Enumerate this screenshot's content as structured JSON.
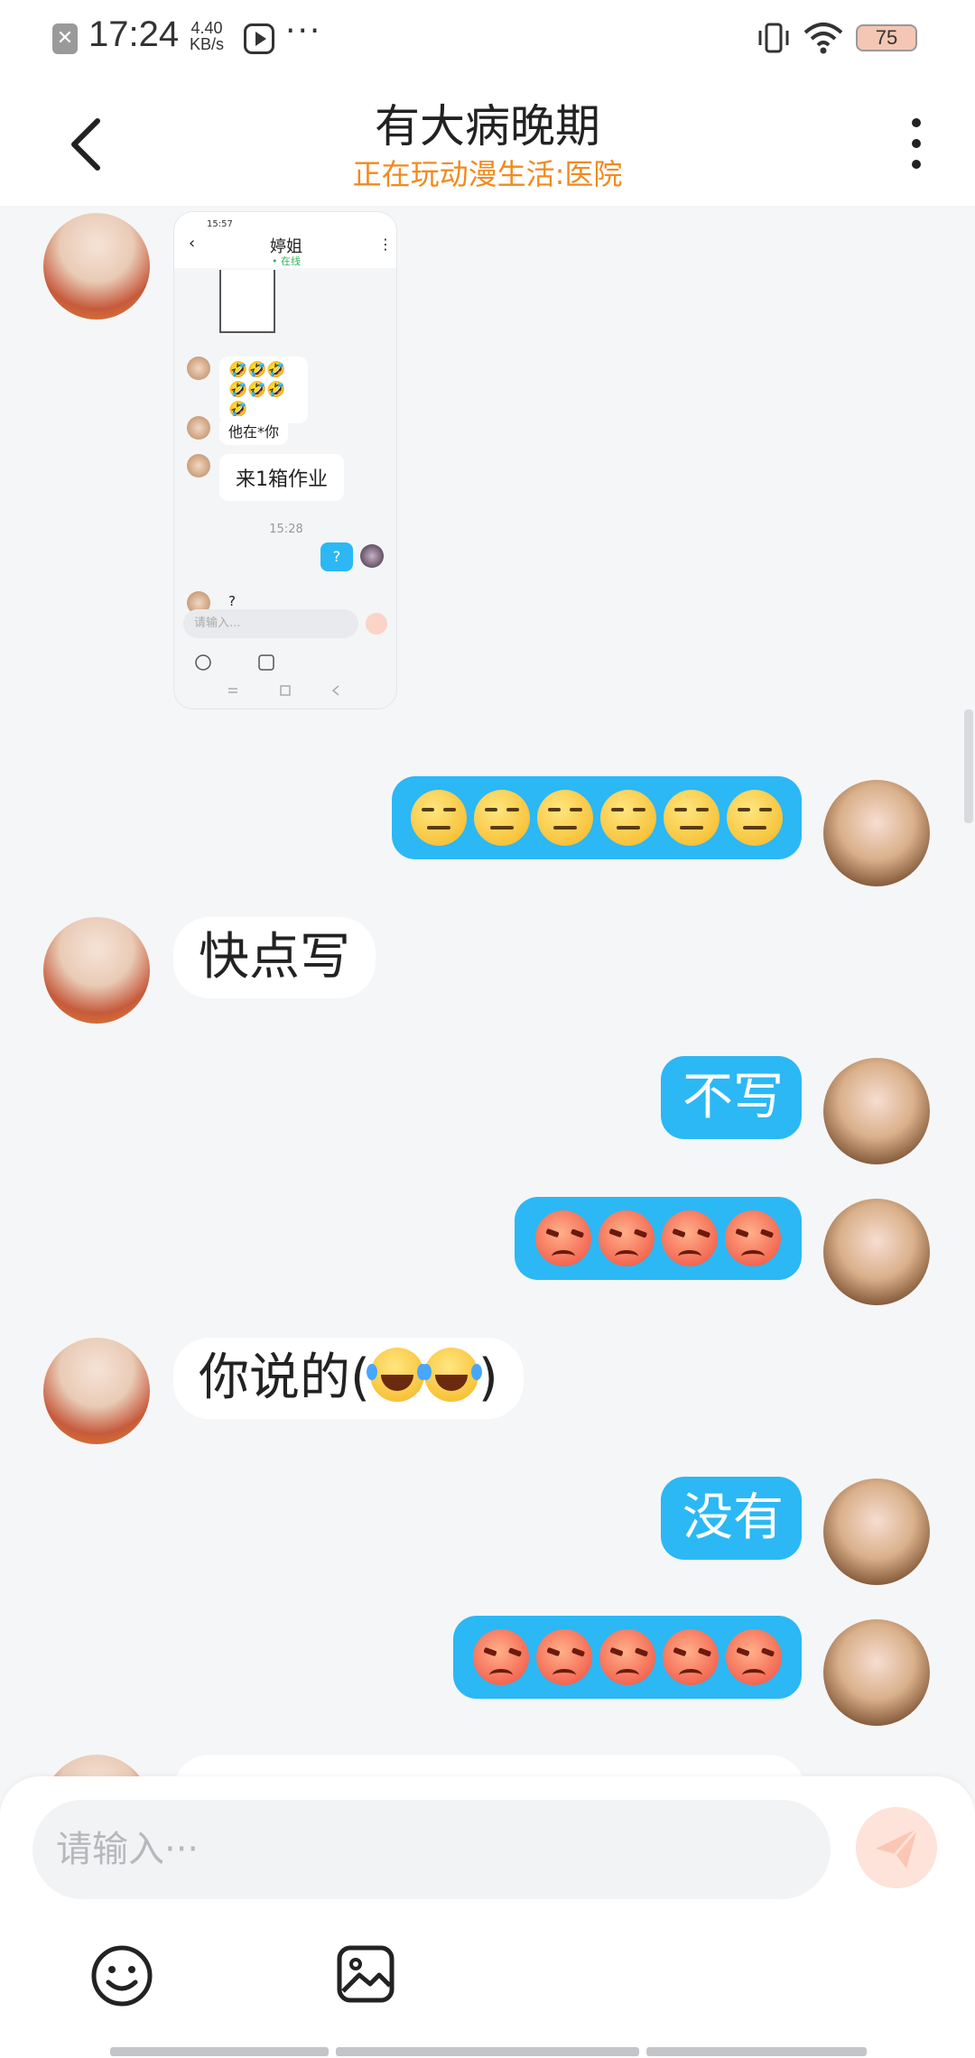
{
  "status_bar": {
    "time": "17:24",
    "speed_value": "4.40",
    "speed_unit": "KB/s",
    "dots": "···",
    "battery": "75"
  },
  "header": {
    "title": "有大病晚期",
    "subtitle": "正在玩动漫生活:医院"
  },
  "screenshot_card": {
    "time": "15:57",
    "contact_name": "婷姐",
    "online_status": "• 在线",
    "messages": [
      "🤣🤣🤣🤣🤣🤣",
      "🤣",
      "他在*你",
      "来1箱作业",
      "?"
    ],
    "timestamp": "15:28",
    "sent": "?",
    "input_placeholder": "请输入..."
  },
  "messages": [
    {
      "from": "other",
      "text": "快点写"
    },
    {
      "from": "me",
      "text": "不写"
    },
    {
      "from": "other",
      "text": "你说的("
    },
    {
      "from": "other",
      "text_end": ")"
    },
    {
      "from": "me",
      "text": "没有"
    }
  ],
  "emoji_groups": {
    "flat_count": 6,
    "angry_first_count": 4,
    "laugh_count": 2,
    "angry_second_count": 5
  },
  "input": {
    "placeholder": "请输入···"
  },
  "colors": {
    "accent_blue": "#2bb8f5",
    "subtitle_orange": "#f28a1e",
    "background": "#f5f6f8"
  }
}
